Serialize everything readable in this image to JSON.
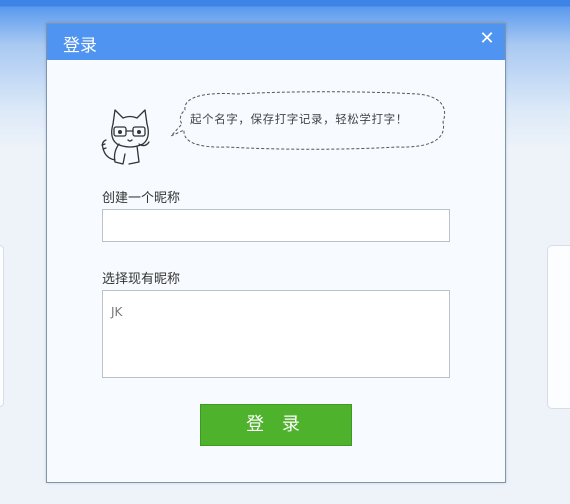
{
  "dialog": {
    "title": "登录",
    "close_icon": "close-icon",
    "speech_bubble": "起个名字，保存打字记录，轻松学打字！",
    "create_nickname": {
      "label": "创建一个昵称",
      "value": ""
    },
    "existing_nickname": {
      "label": "选择现有昵称",
      "items": [
        "JK"
      ]
    },
    "login_button": "登 录"
  },
  "colors": {
    "title_bar": "#4f94f0",
    "login_button": "#4fb22d",
    "dialog_background": "#f7fbff"
  }
}
